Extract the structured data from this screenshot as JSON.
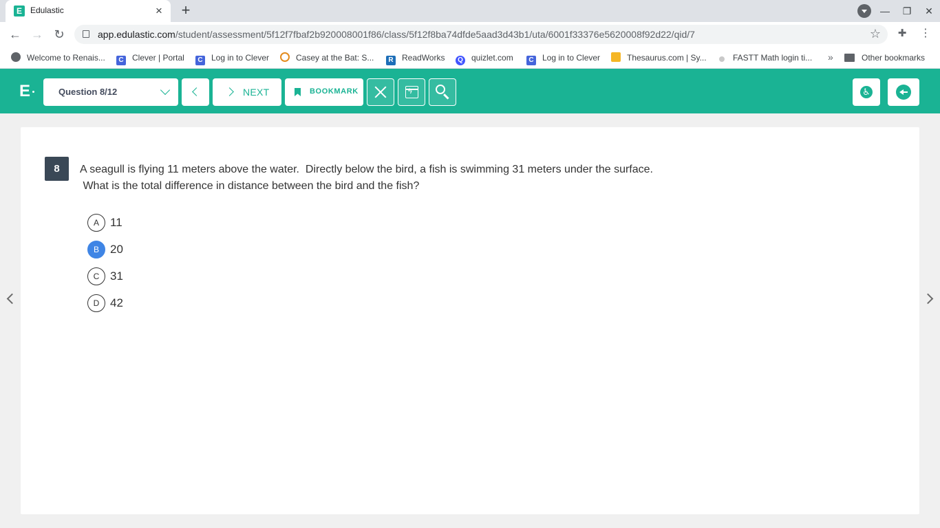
{
  "browser": {
    "tab_title": "Edulastic",
    "tab_favicon_letter": "E",
    "url_host": "app.edulastic.com",
    "url_path": "/student/assessment/5f12f7fbaf2b920008001f86/class/5f12f8ba74dfde5aad3d43b1/uta/6001f33376e5620008f92d22/qid/7"
  },
  "bookmarks": {
    "items": [
      {
        "label": "Welcome to Renais...",
        "icon": "globe-icon"
      },
      {
        "label": "Clever | Portal",
        "icon": "clever-icon"
      },
      {
        "label": "Log in to Clever",
        "icon": "clever-icon"
      },
      {
        "label": "Casey at the Bat: S...",
        "icon": "casey-icon"
      },
      {
        "label": "ReadWorks",
        "icon": "readworks-icon"
      },
      {
        "label": "quizlet.com",
        "icon": "quizlet-icon"
      },
      {
        "label": "Log in to Clever",
        "icon": "clever-icon"
      },
      {
        "label": "Thesaurus.com | Sy...",
        "icon": "thesaurus-icon"
      },
      {
        "label": "FASTT Math login ti...",
        "icon": "fastt-icon"
      }
    ],
    "overflow": "»",
    "other_label": "Other bookmarks"
  },
  "header": {
    "logo": "E",
    "question_selector": "Question 8/12",
    "next_label": "NEXT",
    "bookmark_label": "BOOKMARK",
    "accent_color": "#1ab394"
  },
  "question": {
    "number": "8",
    "stem_line1": "A seagull is flying 11 meters above the water.  Directly below the bird, a fish is swimming 31 meters under the surface.",
    "stem_line2": " What is the total difference in distance between the bird and the fish?",
    "choices": [
      {
        "letter": "A",
        "text": "11",
        "selected": false
      },
      {
        "letter": "B",
        "text": "20",
        "selected": true
      },
      {
        "letter": "C",
        "text": "31",
        "selected": false
      },
      {
        "letter": "D",
        "text": "42",
        "selected": false
      }
    ],
    "selected_color": "#3f85e5"
  }
}
